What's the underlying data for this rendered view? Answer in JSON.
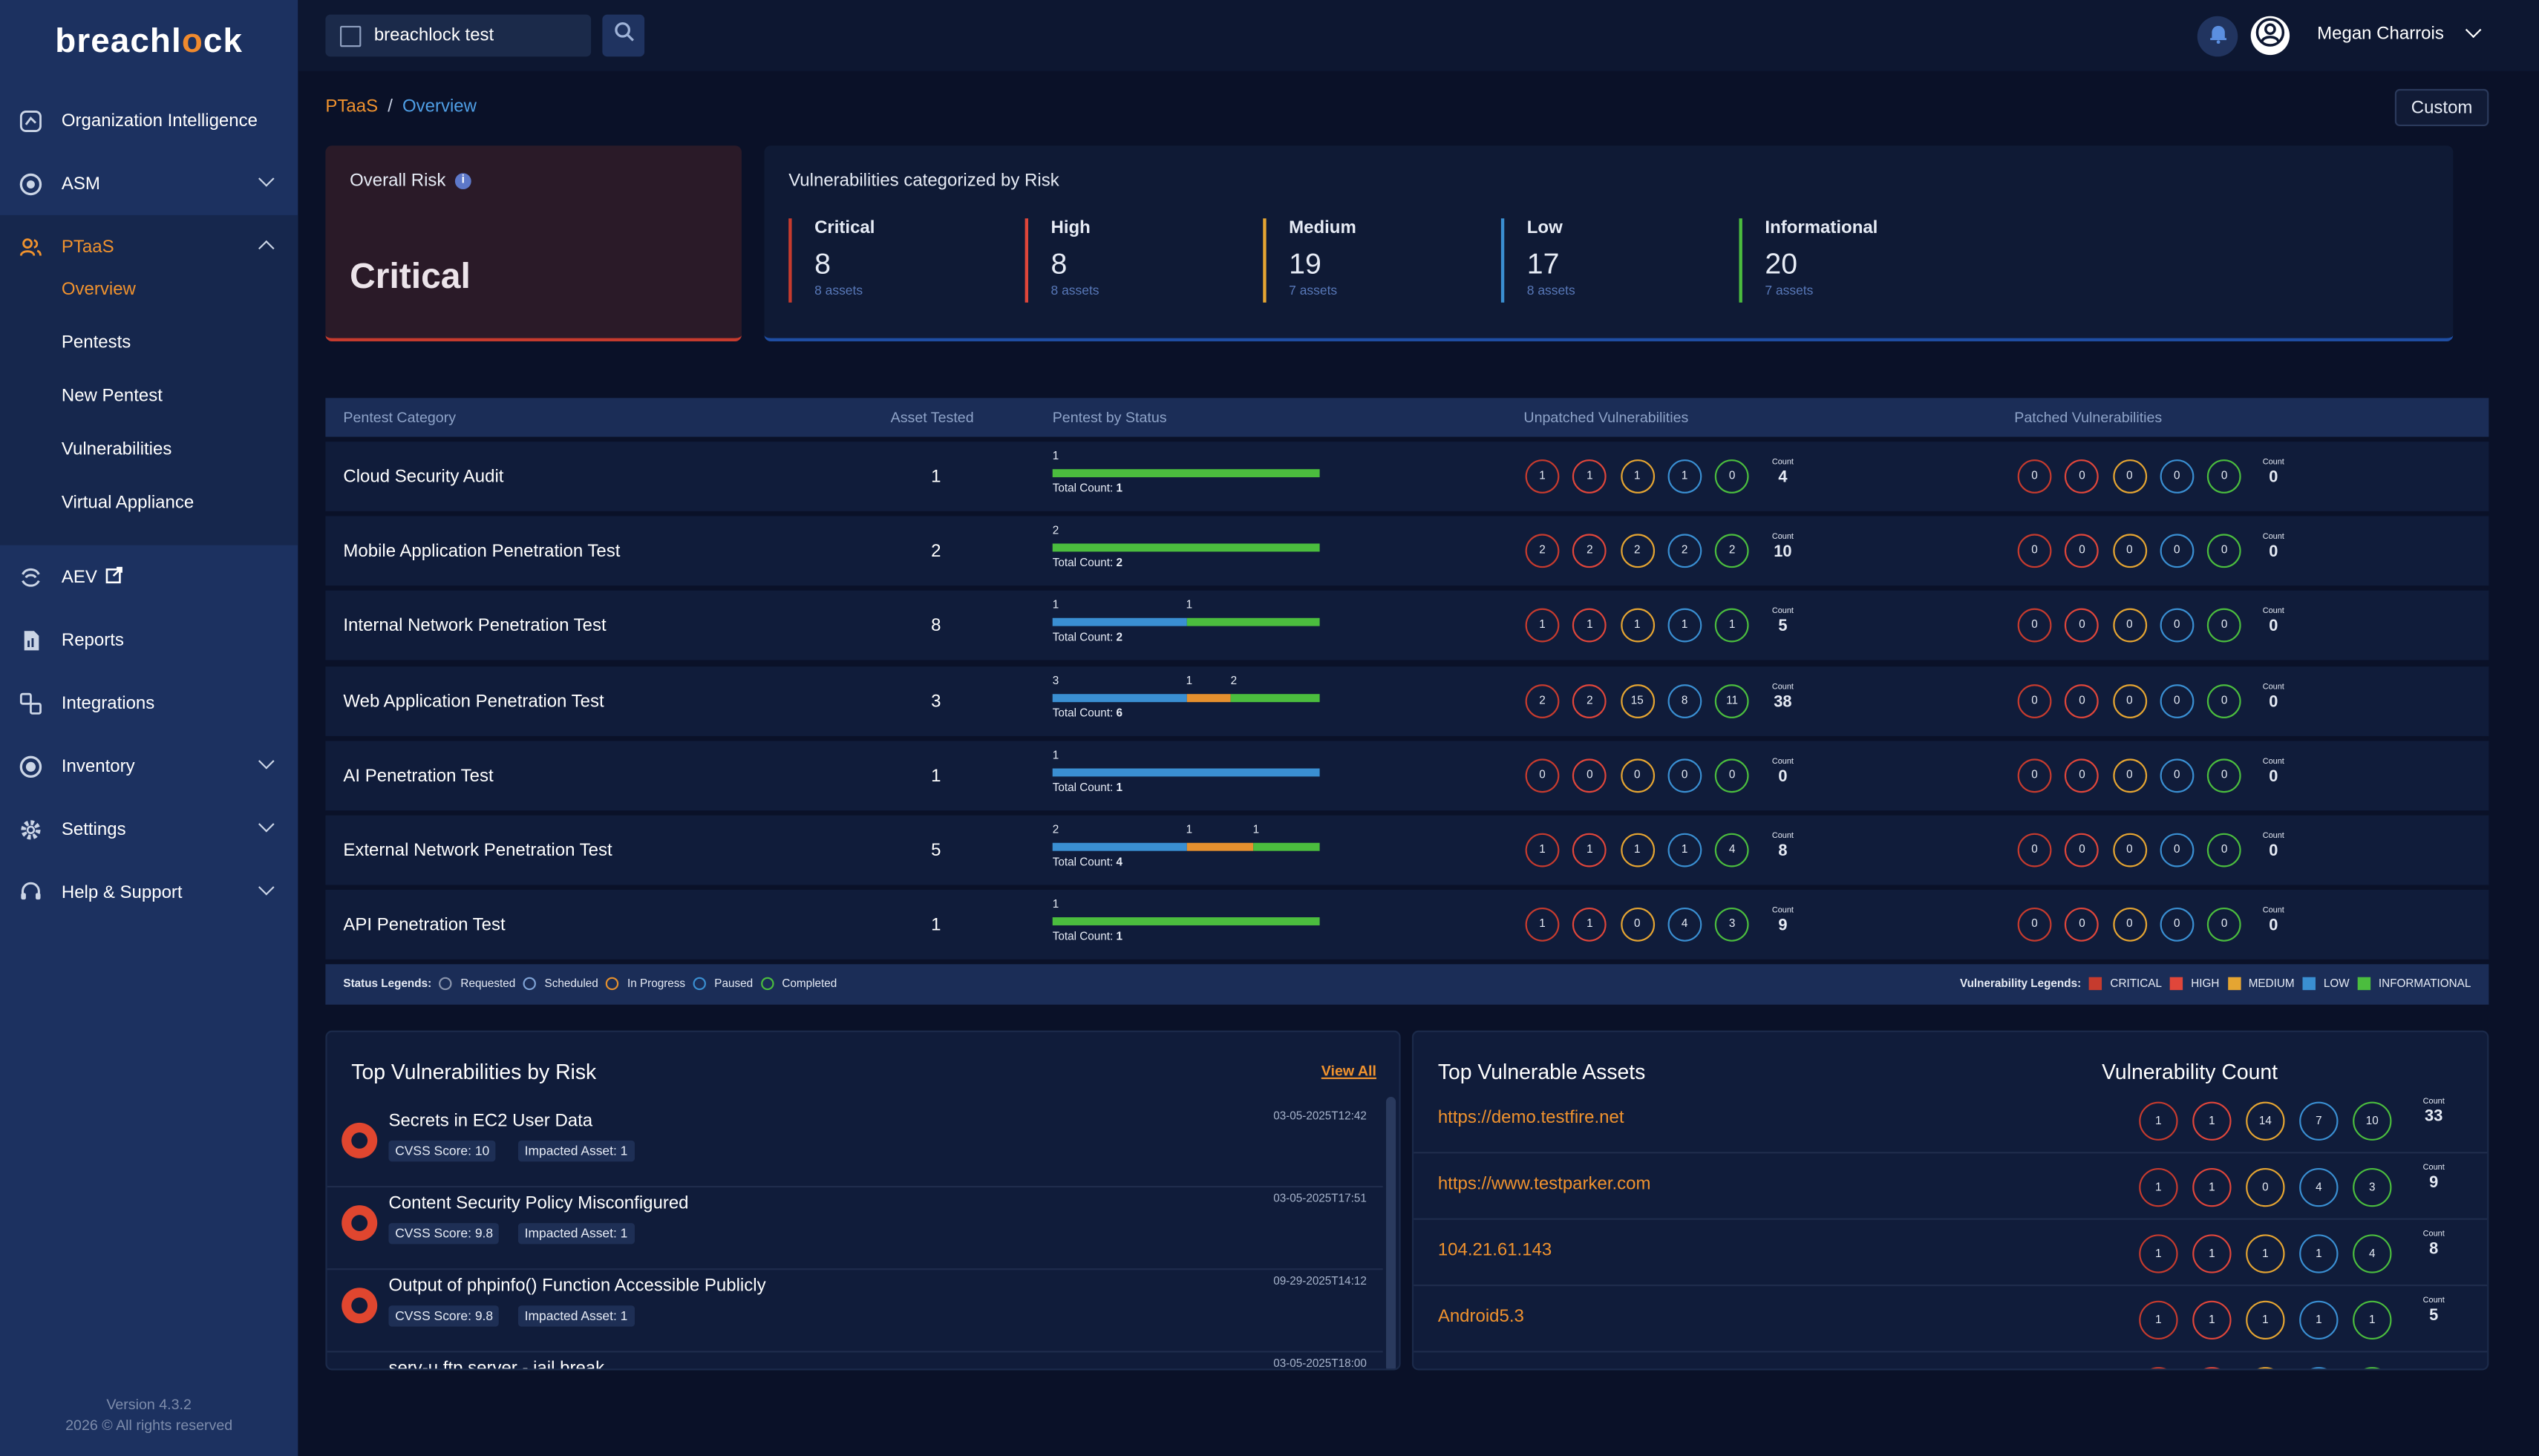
{
  "colors": {
    "critical": "#c63b2e",
    "high": "#e0463a",
    "medium": "#e5a532",
    "low": "#3a8fd2",
    "info": "#4bbd3e",
    "accent": "#f0922e"
  },
  "logo": {
    "text_pre": "breachl",
    "text_o": "o",
    "text_post": "ck"
  },
  "sidebar": {
    "items": [
      {
        "label": "Organization Intelligence",
        "icon": "chart-icon"
      },
      {
        "label": "ASM",
        "icon": "target-icon"
      },
      {
        "label": "PTaaS",
        "icon": "users-icon"
      },
      {
        "label": "AEV",
        "icon": "aev-icon"
      },
      {
        "label": "Reports",
        "icon": "report-icon"
      },
      {
        "label": "Integrations",
        "icon": "integrations-icon"
      },
      {
        "label": "Inventory",
        "icon": "inventory-icon"
      },
      {
        "label": "Settings",
        "icon": "gear-icon"
      },
      {
        "label": "Help & Support",
        "icon": "help-icon"
      }
    ],
    "sub": [
      "Overview",
      "Pentests",
      "New Pentest",
      "Vulnerabilities",
      "Virtual Appliance"
    ],
    "version": "Version 4.3.2",
    "copyright": "2026 © All rights reserved"
  },
  "topbar": {
    "org": "breachlock test",
    "user": "Megan Charrois"
  },
  "breadcrumb": {
    "root": "PTaaS",
    "sep": "/",
    "current": "Overview"
  },
  "custom_label": "Custom",
  "overall": {
    "title": "Overall Risk",
    "value": "Critical"
  },
  "vcat": {
    "title": "Vulnerabilities categorized by Risk",
    "items": [
      {
        "name": "Critical",
        "count": "8",
        "assets": "8 assets"
      },
      {
        "name": "High",
        "count": "8",
        "assets": "8 assets"
      },
      {
        "name": "Medium",
        "count": "19",
        "assets": "7 assets"
      },
      {
        "name": "Low",
        "count": "17",
        "assets": "8 assets"
      },
      {
        "name": "Informational",
        "count": "20",
        "assets": "7 assets"
      }
    ]
  },
  "table": {
    "headers": [
      "Pentest Category",
      "Asset Tested",
      "Pentest by Status",
      "Unpatched Vulnerabilities",
      "Patched Vulnerabilities"
    ],
    "count_label": "Count",
    "total_label": "Total Count:",
    "rows": [
      {
        "name": "Cloud Security Audit",
        "assets": "1",
        "total": "1",
        "segs": [
          {
            "n": 1,
            "s": "completed"
          }
        ],
        "unpatched": [
          "1",
          "1",
          "1",
          "1",
          "0"
        ],
        "ucount": "4",
        "patched": [
          "0",
          "0",
          "0",
          "0",
          "0"
        ],
        "pcount": "0"
      },
      {
        "name": "Mobile Application Penetration Test",
        "assets": "2",
        "total": "2",
        "segs": [
          {
            "n": 2,
            "s": "completed"
          }
        ],
        "unpatched": [
          "2",
          "2",
          "2",
          "2",
          "2"
        ],
        "ucount": "10",
        "patched": [
          "0",
          "0",
          "0",
          "0",
          "0"
        ],
        "pcount": "0"
      },
      {
        "name": "Internal Network Penetration Test",
        "assets": "8",
        "total": "2",
        "segs": [
          {
            "n": 1,
            "s": "paused"
          },
          {
            "n": 1,
            "s": "completed"
          }
        ],
        "unpatched": [
          "1",
          "1",
          "1",
          "1",
          "1"
        ],
        "ucount": "5",
        "patched": [
          "0",
          "0",
          "0",
          "0",
          "0"
        ],
        "pcount": "0"
      },
      {
        "name": "Web Application Penetration Test",
        "assets": "3",
        "total": "6",
        "segs": [
          {
            "n": 3,
            "s": "paused"
          },
          {
            "n": 1,
            "s": "inprogress"
          },
          {
            "n": 2,
            "s": "completed"
          }
        ],
        "unpatched": [
          "2",
          "2",
          "15",
          "8",
          "11"
        ],
        "ucount": "38",
        "patched": [
          "0",
          "0",
          "0",
          "0",
          "0"
        ],
        "pcount": "0"
      },
      {
        "name": "AI Penetration Test",
        "assets": "1",
        "total": "1",
        "segs": [
          {
            "n": 1,
            "s": "paused"
          }
        ],
        "unpatched": [
          "0",
          "0",
          "0",
          "0",
          "0"
        ],
        "ucount": "0",
        "patched": [
          "0",
          "0",
          "0",
          "0",
          "0"
        ],
        "pcount": "0"
      },
      {
        "name": "External Network Penetration Test",
        "assets": "5",
        "total": "4",
        "segs": [
          {
            "n": 2,
            "s": "paused"
          },
          {
            "n": 1,
            "s": "inprogress"
          },
          {
            "n": 1,
            "s": "completed"
          }
        ],
        "unpatched": [
          "1",
          "1",
          "1",
          "1",
          "4"
        ],
        "ucount": "8",
        "patched": [
          "0",
          "0",
          "0",
          "0",
          "0"
        ],
        "pcount": "0"
      },
      {
        "name": "API Penetration Test",
        "assets": "1",
        "total": "1",
        "segs": [
          {
            "n": 1,
            "s": "completed"
          }
        ],
        "unpatched": [
          "1",
          "1",
          "0",
          "4",
          "3"
        ],
        "ucount": "9",
        "patched": [
          "0",
          "0",
          "0",
          "0",
          "0"
        ],
        "pcount": "0"
      }
    ]
  },
  "legends": {
    "status_title": "Status Legends:",
    "status": [
      "Requested",
      "Scheduled",
      "In Progress",
      "Paused",
      "Completed"
    ],
    "vuln_title": "Vulnerability Legends:",
    "vuln": [
      "CRITICAL",
      "HIGH",
      "MEDIUM",
      "LOW",
      "INFORMATIONAL"
    ]
  },
  "top_vulns": {
    "title": "Top Vulnerabilities by Risk",
    "view_all": "View All",
    "items": [
      {
        "title": "Secrets in EC2 User Data",
        "date": "03-05-2025T12:42",
        "cvss": "CVSS Score: 10",
        "impacted": "Impacted Asset: 1"
      },
      {
        "title": "Content Security Policy Misconfigured",
        "date": "03-05-2025T17:51",
        "cvss": "CVSS Score: 9.8",
        "impacted": "Impacted Asset: 1"
      },
      {
        "title": "Output of phpinfo() Function Accessible Publicly",
        "date": "09-29-2025T14:12",
        "cvss": "CVSS Score: 9.8",
        "impacted": "Impacted Asset: 1"
      },
      {
        "title": "serv-u ftp server - jail break",
        "date": "03-05-2025T18:00",
        "cvss": "",
        "impacted": ""
      }
    ]
  },
  "top_assets": {
    "title": "Top Vulnerable Assets",
    "count_title": "Vulnerability Count",
    "items": [
      {
        "name": "https://demo.testfire.net",
        "counts": [
          "1",
          "1",
          "14",
          "7",
          "10"
        ],
        "total": "33"
      },
      {
        "name": "https://www.testparker.com",
        "counts": [
          "1",
          "1",
          "0",
          "4",
          "3"
        ],
        "total": "9"
      },
      {
        "name": "104.21.61.143",
        "counts": [
          "1",
          "1",
          "1",
          "1",
          "4"
        ],
        "total": "8"
      },
      {
        "name": "Android5.3",
        "counts": [
          "1",
          "1",
          "1",
          "1",
          "1"
        ],
        "total": "5"
      }
    ]
  }
}
